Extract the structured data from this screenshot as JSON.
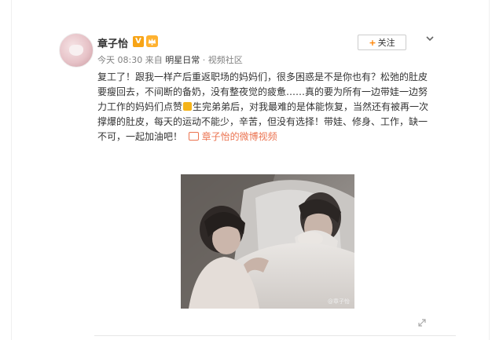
{
  "post": {
    "username": "章子怡",
    "verified_badge": "V",
    "meta": {
      "time": "今天 08:30",
      "from_label": "来自",
      "source": "明星日常",
      "separator": "·",
      "community": "视频社区"
    },
    "follow_label": "关注",
    "text_lines": [
      "复工了！跟我一样产后重返职场的妈妈们，很多困惑是不是你也有？松弛的肚皮",
      "要瘦回去，不间断的备奶，没有整夜觉的疲惫……真的要为所有一边带娃一边努",
      "力工作的妈妈们点赞",
      "生完弟弟后，对我最难的是体能恢复，当然还有被再一次",
      "撑爆的肚皮，每天的运动不能少，辛苦，但没有选择！带娃、修身、工作，缺一",
      "不可，一起加油吧！"
    ],
    "video_link": "章子怡的微博视频",
    "photo_watermark": "@章子怡"
  },
  "icons": {
    "verified": "verified-v-icon",
    "crown": "crown-icon",
    "chevron": "chevron-down-icon",
    "thumb": "thumbs-up-emoji-icon",
    "video": "video-icon",
    "expand": "expand-icon"
  },
  "colors": {
    "accent_orange": "#ff8200",
    "link": "#eb7350",
    "verified_gold": "#f7a416",
    "meta_gray": "#808080"
  }
}
